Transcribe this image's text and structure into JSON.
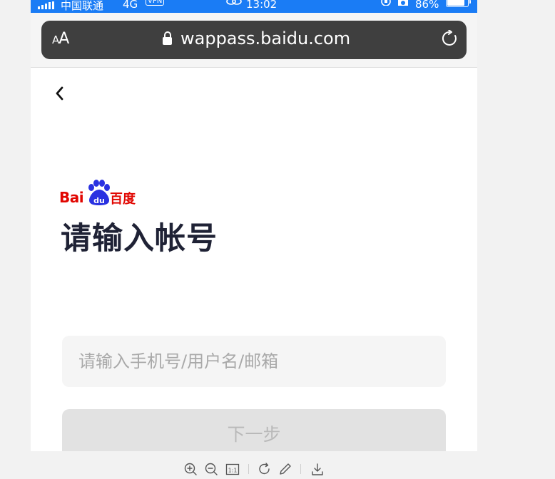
{
  "status_bar": {
    "carrier": "中国联通",
    "network": "4G",
    "vpn": "VPN",
    "time": "13:02",
    "battery": "86%",
    "battery_level": 0.86,
    "color": "#1a7cf5"
  },
  "browser": {
    "text_size_small": "A",
    "text_size_large": "A",
    "url": "wappass.baidu.com"
  },
  "page": {
    "logo_text_left": "Bai",
    "logo_text_paw": "du",
    "logo_text_right": "百度",
    "title": "请输入帐号",
    "input_placeholder": "请输入手机号/用户名/邮箱",
    "input_value": "",
    "next_button": "下一步"
  },
  "colors": {
    "brand_red": "#e10601",
    "brand_blue": "#2a32e1",
    "title": "#1f2235",
    "disabled_button": "#e2e2e2"
  },
  "viewer_toolbar": {
    "actual_size": "1:1",
    "icons": [
      "zoom-in-icon",
      "zoom-out-icon",
      "actual-size-icon",
      "rotate-icon",
      "edit-icon",
      "download-icon"
    ]
  }
}
